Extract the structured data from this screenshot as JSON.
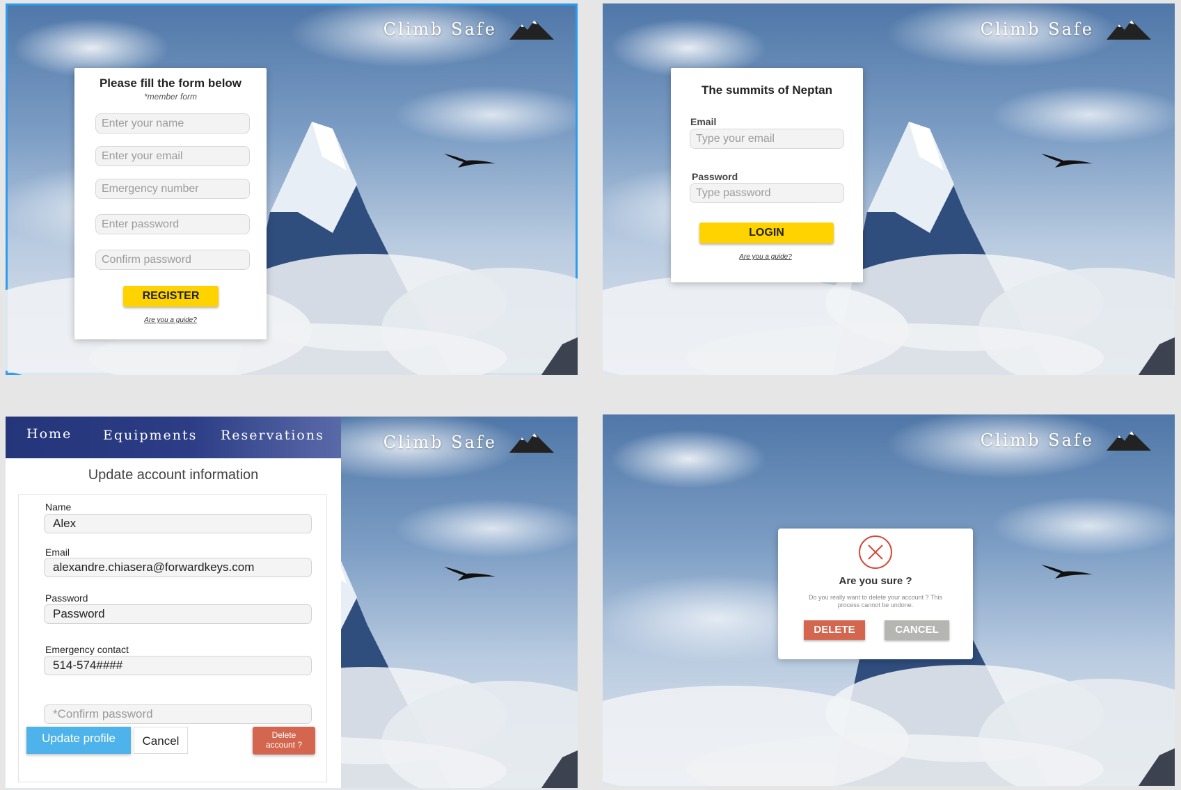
{
  "brand": {
    "name": "Climb Safe",
    "logo_icon": "mountain-icon"
  },
  "register_screen": {
    "title": "Please fill the form below",
    "subtitle": "*member form",
    "name_placeholder": "Enter your name",
    "email_placeholder": "Enter your email",
    "emergency_placeholder": "Emergency number",
    "password_placeholder": "Enter password",
    "confirm_placeholder": "Confirm password",
    "register_label": "REGISTER",
    "guide_link": "Are you a guide?"
  },
  "login_screen": {
    "title": "The summits of Neptan",
    "email_label": "Email",
    "email_placeholder": "Type your email",
    "password_label": "Password",
    "password_placeholder": "Type password",
    "login_label": "LOGIN",
    "guide_link": "Are you a guide?"
  },
  "update_screen": {
    "nav": [
      "Home",
      "Equipments",
      "Reservations"
    ],
    "title": "Update account information",
    "name_label": "Name",
    "name_value": "Alex",
    "email_label": "Email",
    "email_value": "alexandre.chiasera@forwardkeys.com",
    "password_label": "Password",
    "password_value": "Password",
    "emergency_label": "Emergency contact",
    "emergency_value": "514-574####",
    "confirm_placeholder": "*Confirm password",
    "update_label": "Update profile",
    "cancel_label": "Cancel",
    "delete_label_line1": "Delete",
    "delete_label_line2": "account ?"
  },
  "delete_dialog": {
    "title": "Are you sure ?",
    "message_line1": "Do you really want to delete your account ? This",
    "message_line2": "process cannot be undone.",
    "delete_label": "DELETE",
    "cancel_label": "CANCEL"
  },
  "colors": {
    "accent_yellow": "#ffd300",
    "selection_blue": "#2d9cf0",
    "nav_blue": "#2c3d86",
    "update_blue": "#4db3ea",
    "delete_red": "#d4664f",
    "cancel_gray": "#b5b5b2"
  }
}
